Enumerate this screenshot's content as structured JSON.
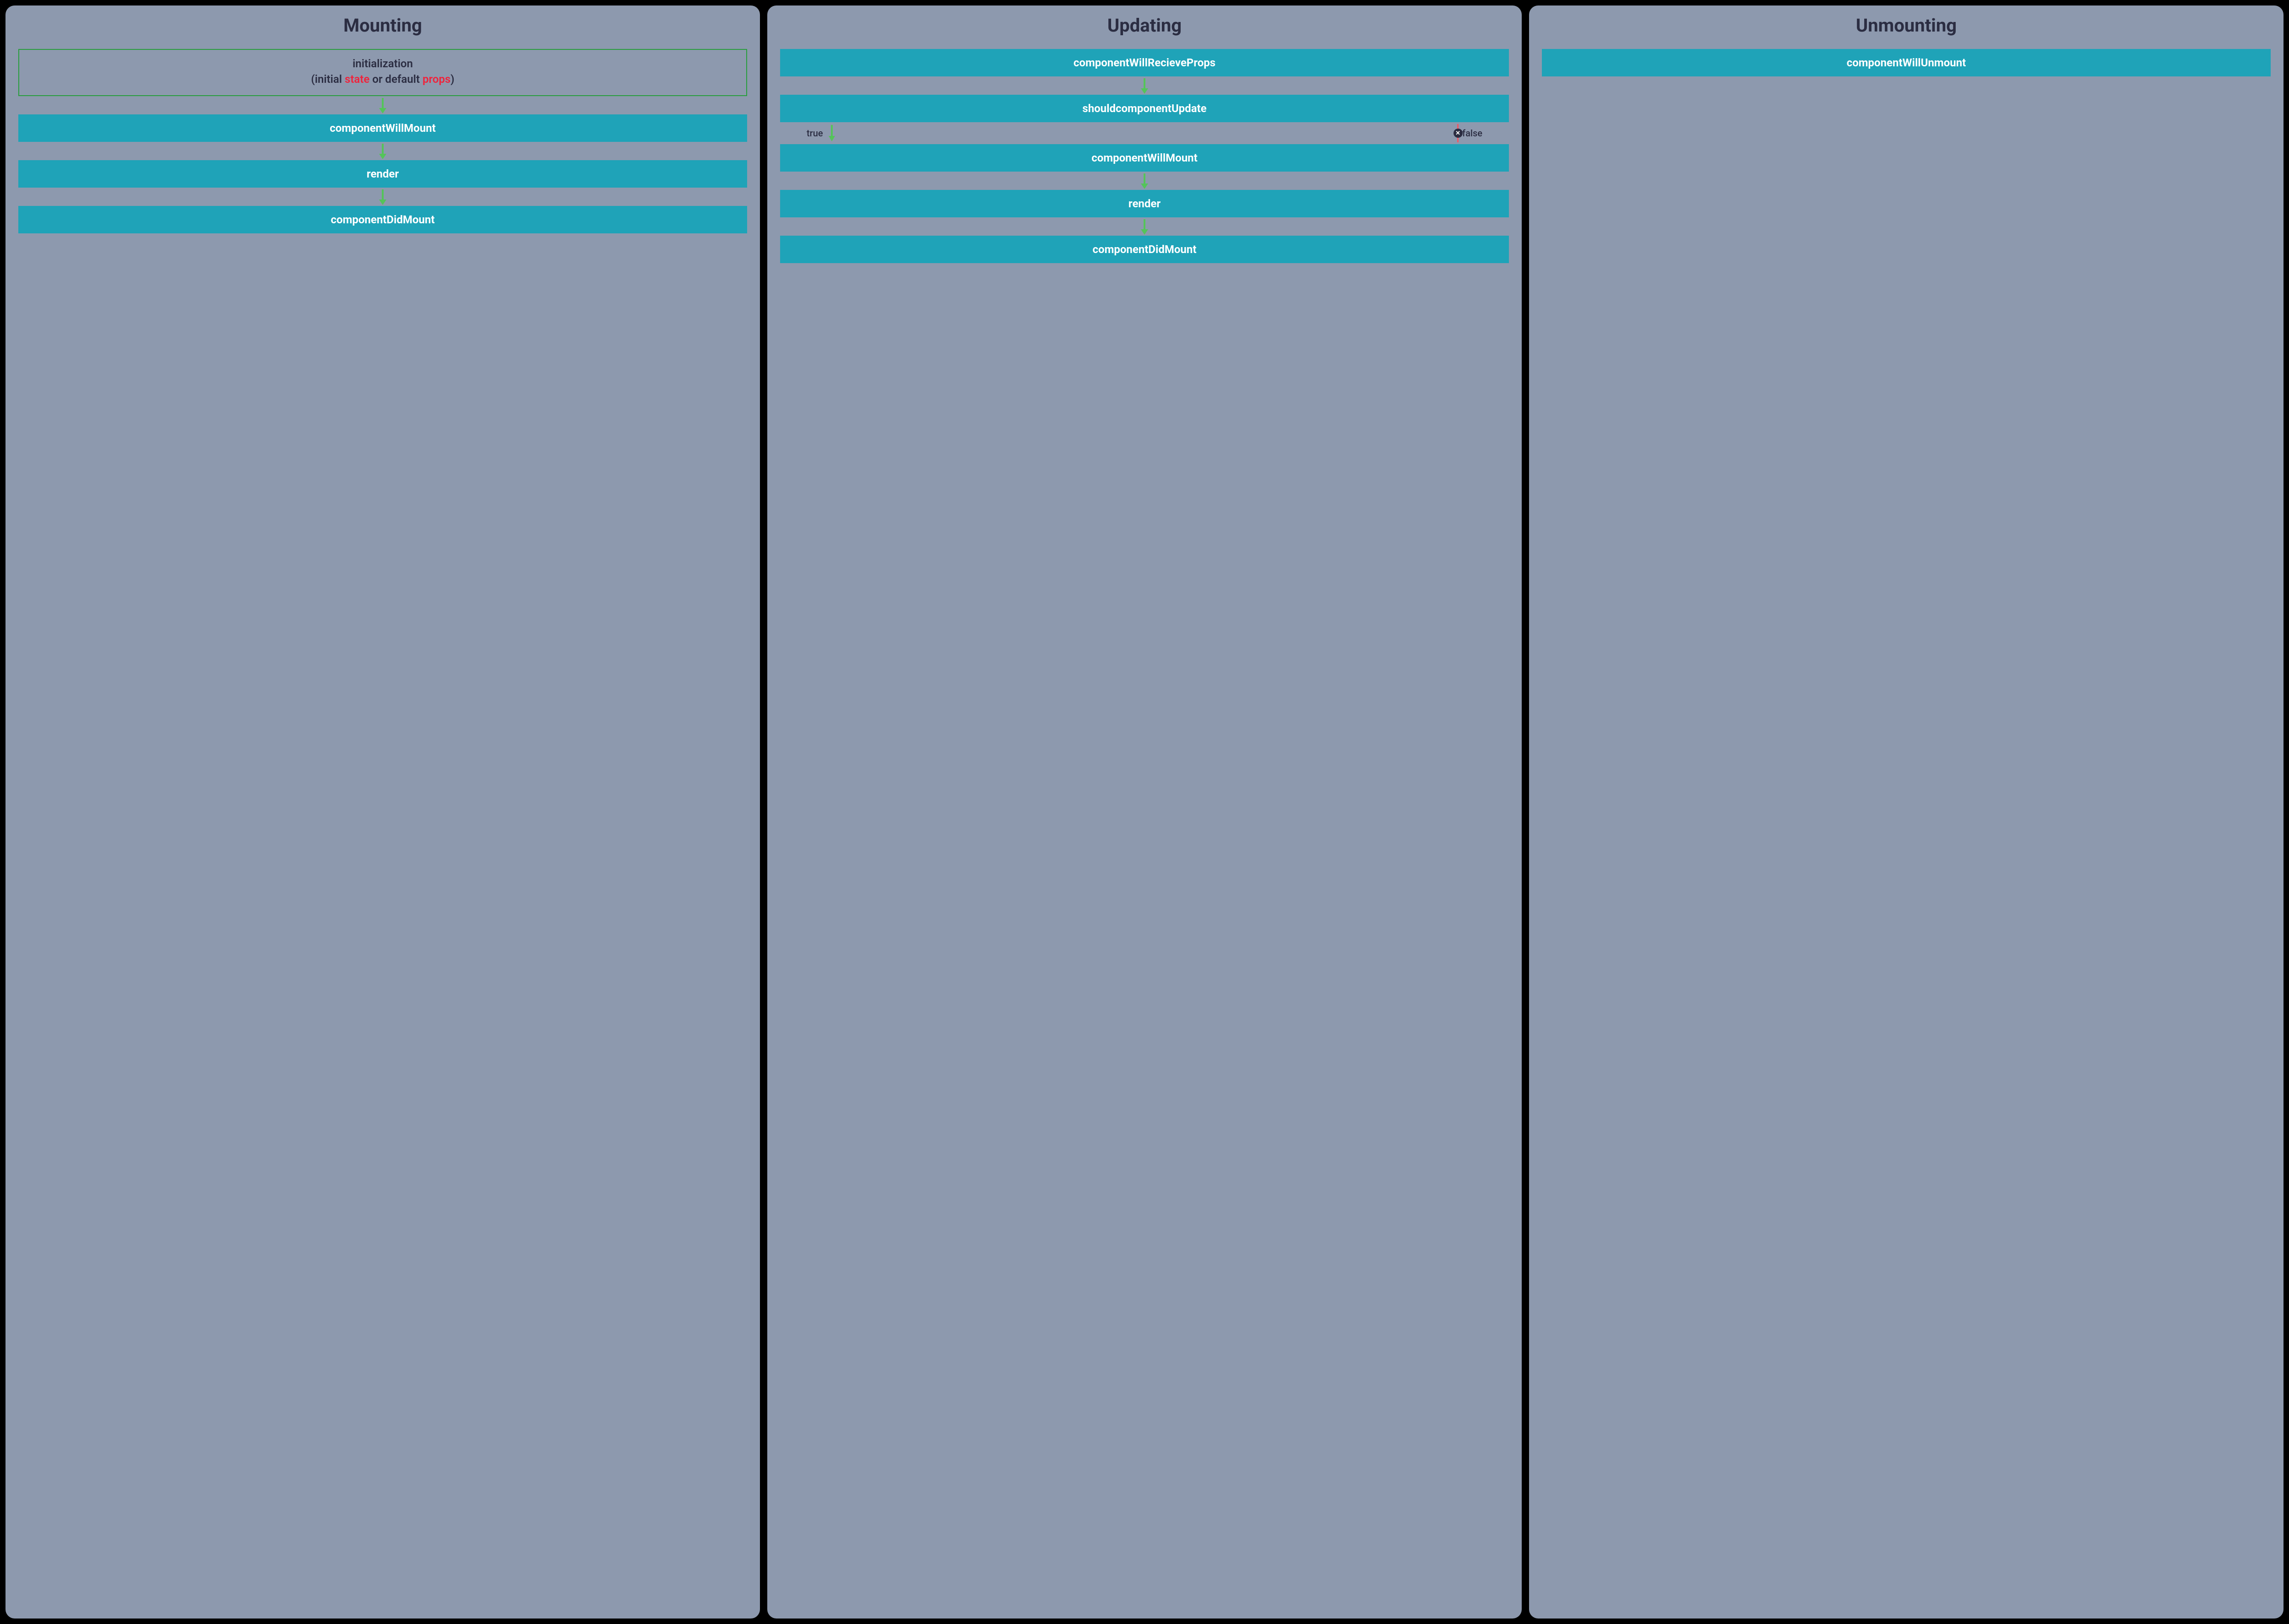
{
  "colors": {
    "panel_bg": "#8d99ae",
    "step_bg": "#1fa3b8",
    "text_dark": "#2b2d42",
    "accent_red": "#ef233c",
    "arrow_green": "#54c45a",
    "false_line": "#ef5765",
    "init_border": "#2a9d3f"
  },
  "mounting": {
    "title": "Mounting",
    "init_line1": "initialization",
    "init_prefix": "(initial ",
    "init_state": "state",
    "init_mid": " or default ",
    "init_props": "props",
    "init_suffix": ")",
    "steps": {
      "s1": "componentWillMount",
      "s2": "render",
      "s3": "componentDidMount"
    }
  },
  "updating": {
    "title": "Updating",
    "branch_true": "true",
    "branch_false": "false",
    "x_mark": "✕",
    "steps": {
      "s1": "componentWillRecieveProps",
      "s2": "shouldcomponentUpdate",
      "s3": "componentWillMount",
      "s4": "render",
      "s5": "componentDidMount"
    }
  },
  "unmounting": {
    "title": "Unmounting",
    "steps": {
      "s1": "componentWillUnmount"
    }
  }
}
